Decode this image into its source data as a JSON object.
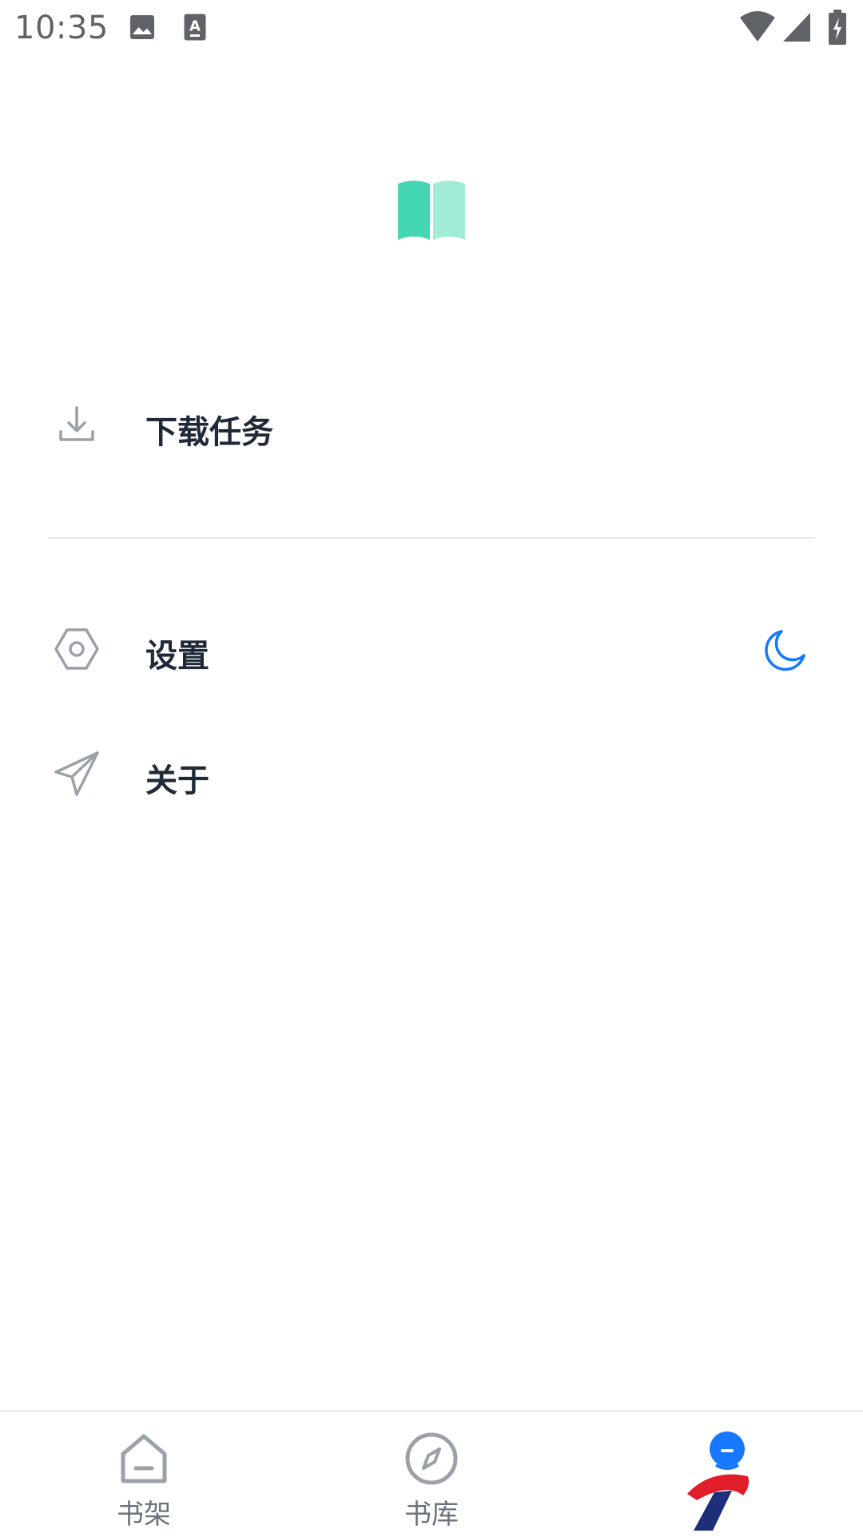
{
  "status_bar": {
    "time": "10:35",
    "icons": [
      "image-icon",
      "text-a-icon",
      "wifi-icon",
      "signal-icon",
      "battery-charging-icon"
    ]
  },
  "header": {
    "logo_icon": "open-book-icon",
    "logo_colors": [
      "#45d6b5",
      "#a2ecda"
    ]
  },
  "menu": {
    "items": [
      {
        "label": "下载任务",
        "icon": "download-icon"
      },
      {
        "label": "设置",
        "icon": "settings-hexagon-icon",
        "trailing_icon": "moon-icon"
      },
      {
        "label": "关于",
        "icon": "paper-plane-icon"
      }
    ]
  },
  "bottom_nav": {
    "items": [
      {
        "label": "书架",
        "icon": "home-icon",
        "active": false
      },
      {
        "label": "书库",
        "icon": "compass-icon",
        "active": false
      },
      {
        "label": "",
        "icon": "profile-brand-icon",
        "active": true
      }
    ]
  },
  "colors": {
    "accent": "#1677ff",
    "icon_gray": "#9aa1aa",
    "text_dark": "#1f2937",
    "nav_inactive": "#6b7280",
    "brand_red": "#e11d2a",
    "brand_navy": "#1e2f7a"
  }
}
